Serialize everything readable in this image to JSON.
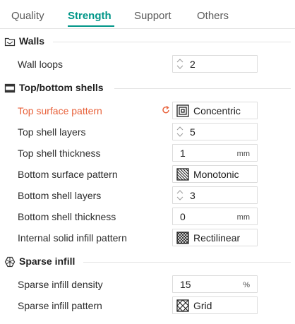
{
  "tabs": [
    {
      "label": "Quality",
      "active": false
    },
    {
      "label": "Strength",
      "active": true
    },
    {
      "label": "Support",
      "active": false
    },
    {
      "label": "Others",
      "active": false
    }
  ],
  "colors": {
    "accent": "#009688",
    "modified": "#e8613a"
  },
  "sections": {
    "walls": {
      "title": "Walls",
      "icon": "walls-icon",
      "wall_loops": {
        "label": "Wall loops",
        "value": "2"
      }
    },
    "top_bottom": {
      "title": "Top/bottom shells",
      "icon": "shells-icon",
      "top_surface_pattern": {
        "label": "Top surface pattern",
        "value": "Concentric",
        "icon": "concentric-pattern-icon",
        "modified": true
      },
      "top_shell_layers": {
        "label": "Top shell layers",
        "value": "5"
      },
      "top_shell_thickness": {
        "label": "Top shell thickness",
        "value": "1",
        "unit": "mm"
      },
      "bottom_surface_pattern": {
        "label": "Bottom surface pattern",
        "value": "Monotonic",
        "icon": "monotonic-pattern-icon"
      },
      "bottom_shell_layers": {
        "label": "Bottom shell layers",
        "value": "3"
      },
      "bottom_shell_thickness": {
        "label": "Bottom shell thickness",
        "value": "0",
        "unit": "mm"
      },
      "internal_solid_infill_pattern": {
        "label": "Internal solid infill pattern",
        "value": "Rectilinear",
        "icon": "rectilinear-pattern-icon"
      }
    },
    "sparse_infill": {
      "title": "Sparse infill",
      "icon": "infill-icon",
      "density": {
        "label": "Sparse infill density",
        "value": "15",
        "unit": "%"
      },
      "pattern": {
        "label": "Sparse infill pattern",
        "value": "Grid",
        "icon": "grid-pattern-icon"
      }
    }
  }
}
